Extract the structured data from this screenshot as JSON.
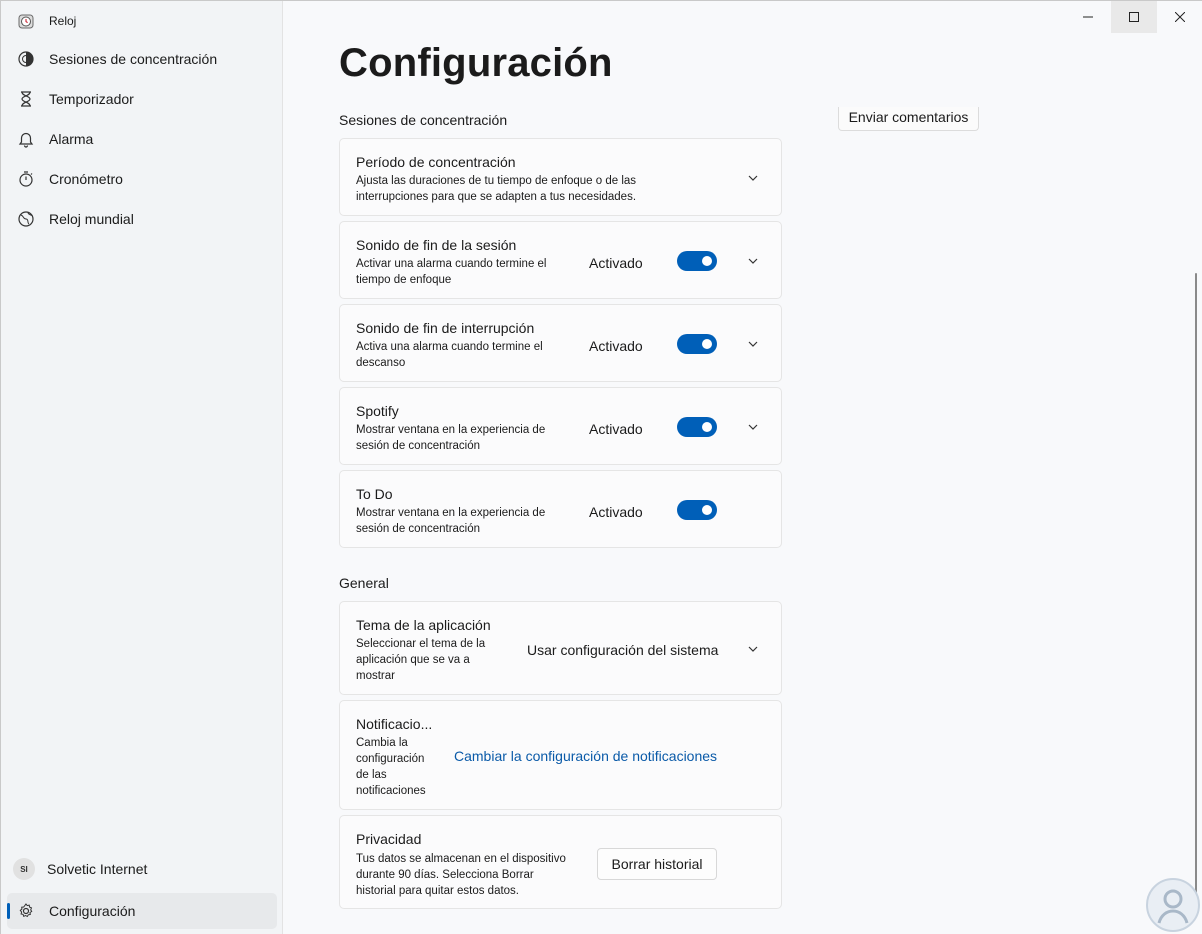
{
  "app": {
    "title": "Reloj"
  },
  "sidebar": {
    "items": [
      {
        "label": "Sesiones de concentración",
        "icon": "focus-icon"
      },
      {
        "label": "Temporizador",
        "icon": "hourglass-icon"
      },
      {
        "label": "Alarma",
        "icon": "bell-icon"
      },
      {
        "label": "Cronómetro",
        "icon": "stopwatch-icon"
      },
      {
        "label": "Reloj mundial",
        "icon": "globe-icon"
      }
    ],
    "account": {
      "initials": "SI",
      "name": "Solvetic Internet"
    },
    "settings": {
      "label": "Configuración",
      "icon": "gear-icon"
    }
  },
  "main": {
    "title": "Configuración",
    "feedback_label": "Enviar comentarios",
    "sections": {
      "focus": "Sesiones de concentración",
      "general": "General"
    },
    "focus_cards": [
      {
        "title": "Período de concentración",
        "desc1": "Ajusta las duraciones de tu tiempo de enfoque o de las",
        "desc2": "interrupciones para que se adapten a tus necesidades."
      },
      {
        "title": "Sonido de fin de la sesión",
        "desc1": "Activar una alarma cuando termine el",
        "desc2": "tiempo de enfoque",
        "state": "Activado"
      },
      {
        "title": "Sonido de fin de interrupción",
        "desc1": "Activa una alarma cuando termine el",
        "desc2": "descanso",
        "state": "Activado"
      },
      {
        "title": "Spotify",
        "desc1": "Mostrar ventana en la experiencia de",
        "desc2": "sesión de concentración",
        "state": "Activado"
      },
      {
        "title": "To Do",
        "desc1": "Mostrar ventana en la experiencia de",
        "desc2": "sesión de concentración",
        "state": "Activado"
      }
    ],
    "theme": {
      "title": "Tema de la aplicación",
      "desc1": "Seleccionar el tema de la",
      "desc2": "aplicación que se va a",
      "desc3": "mostrar",
      "value": "Usar configuración del sistema"
    },
    "notifications": {
      "title": "Notificacio...",
      "desc1": "Cambia la",
      "desc2": "configuración",
      "desc3": "de las",
      "desc4": "notificaciones",
      "link": "Cambiar la configuración de notificaciones"
    },
    "privacy": {
      "title": "Privacidad",
      "desc1": "Tus datos se almacenan en el dispositivo",
      "desc2": "durante 90 días. Selecciona Borrar",
      "desc3": "historial para quitar estos datos.",
      "button": "Borrar historial"
    }
  },
  "colors": {
    "accent": "#005fb8",
    "link": "#0a5aa8"
  }
}
